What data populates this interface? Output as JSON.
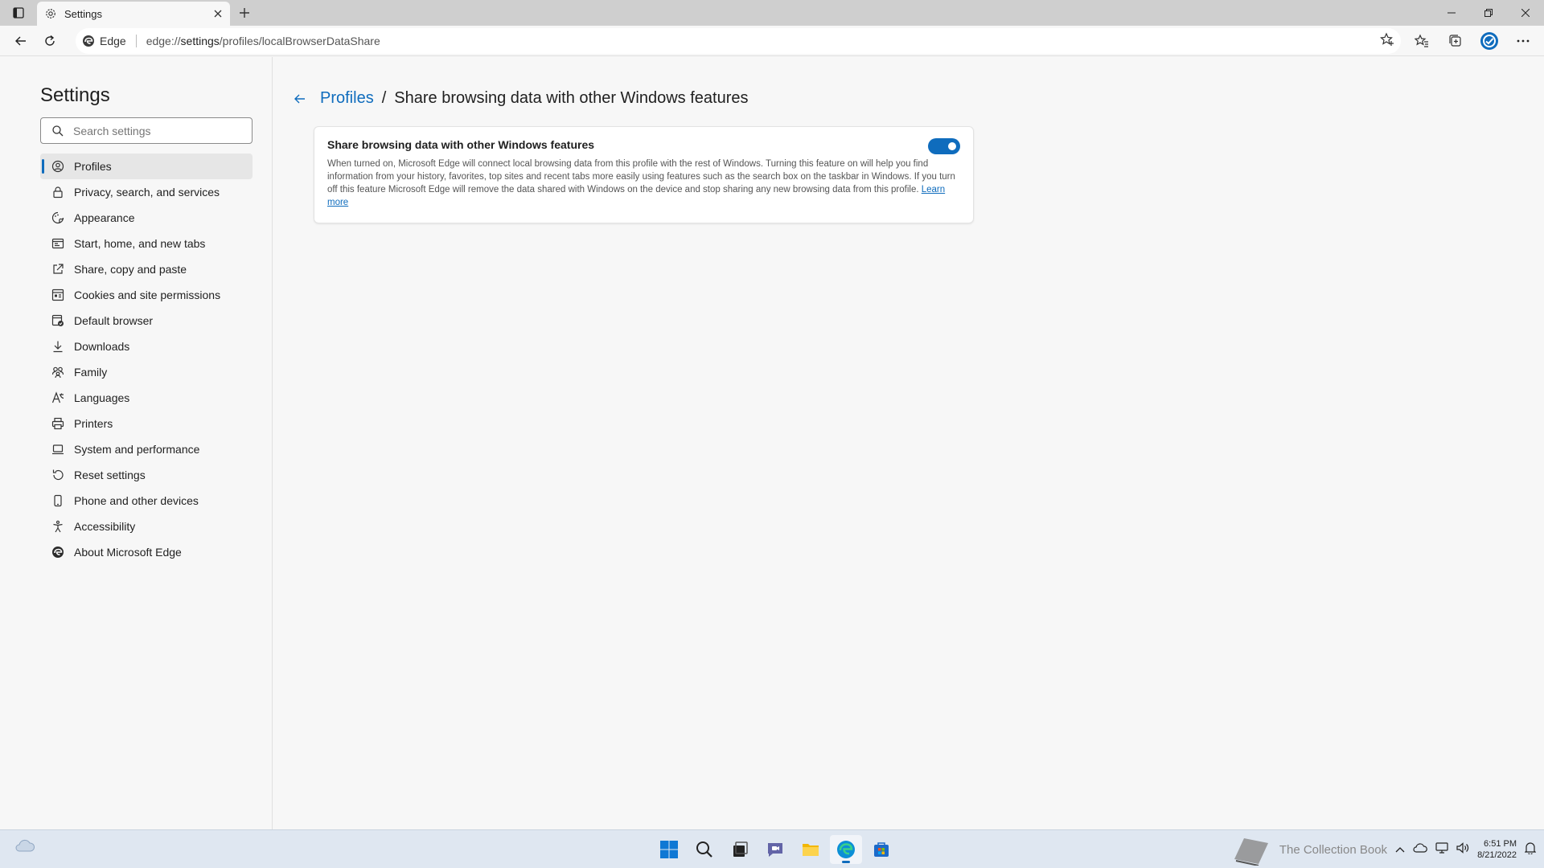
{
  "browser": {
    "tab_title": "Settings",
    "site_label": "Edge",
    "url_prefix": "edge://",
    "url_host": "settings",
    "url_path": "/profiles/localBrowserDataShare"
  },
  "sidebar": {
    "title": "Settings",
    "search_placeholder": "Search settings",
    "items": [
      {
        "label": "Profiles",
        "icon": "profile-icon"
      },
      {
        "label": "Privacy, search, and services",
        "icon": "lock-icon"
      },
      {
        "label": "Appearance",
        "icon": "appearance-icon"
      },
      {
        "label": "Start, home, and new tabs",
        "icon": "home-tabs-icon"
      },
      {
        "label": "Share, copy and paste",
        "icon": "share-icon"
      },
      {
        "label": "Cookies and site permissions",
        "icon": "cookies-icon"
      },
      {
        "label": "Default browser",
        "icon": "default-browser-icon"
      },
      {
        "label": "Downloads",
        "icon": "download-icon"
      },
      {
        "label": "Family",
        "icon": "family-icon"
      },
      {
        "label": "Languages",
        "icon": "languages-icon"
      },
      {
        "label": "Printers",
        "icon": "printer-icon"
      },
      {
        "label": "System and performance",
        "icon": "laptop-icon"
      },
      {
        "label": "Reset settings",
        "icon": "reset-icon"
      },
      {
        "label": "Phone and other devices",
        "icon": "phone-icon"
      },
      {
        "label": "Accessibility",
        "icon": "accessibility-icon"
      },
      {
        "label": "About Microsoft Edge",
        "icon": "edge-logo-icon"
      }
    ]
  },
  "main": {
    "breadcrumb_parent": "Profiles",
    "breadcrumb_separator": "/",
    "breadcrumb_current": "Share browsing data with other Windows features",
    "card": {
      "title": "Share browsing data with other Windows features",
      "toggle_on": true,
      "description": "When turned on, Microsoft Edge will connect local browsing data from this profile with the rest of Windows. Turning this feature on will help you find information from your history, favorites, top sites and recent tabs more easily using features such as the search box on the taskbar in Windows. If you turn off this feature Microsoft Edge will remove the data shared with Windows on the device and stop sharing any new browsing data from this profile.",
      "learn_more": "Learn more"
    }
  },
  "taskbar": {
    "time": "6:51 PM",
    "date": "8/21/2022",
    "tray_text": "The Collection Book"
  },
  "colors": {
    "accent": "#0f6cbd",
    "background": "#f7f7f7",
    "taskbar": "#dfe7f1"
  }
}
